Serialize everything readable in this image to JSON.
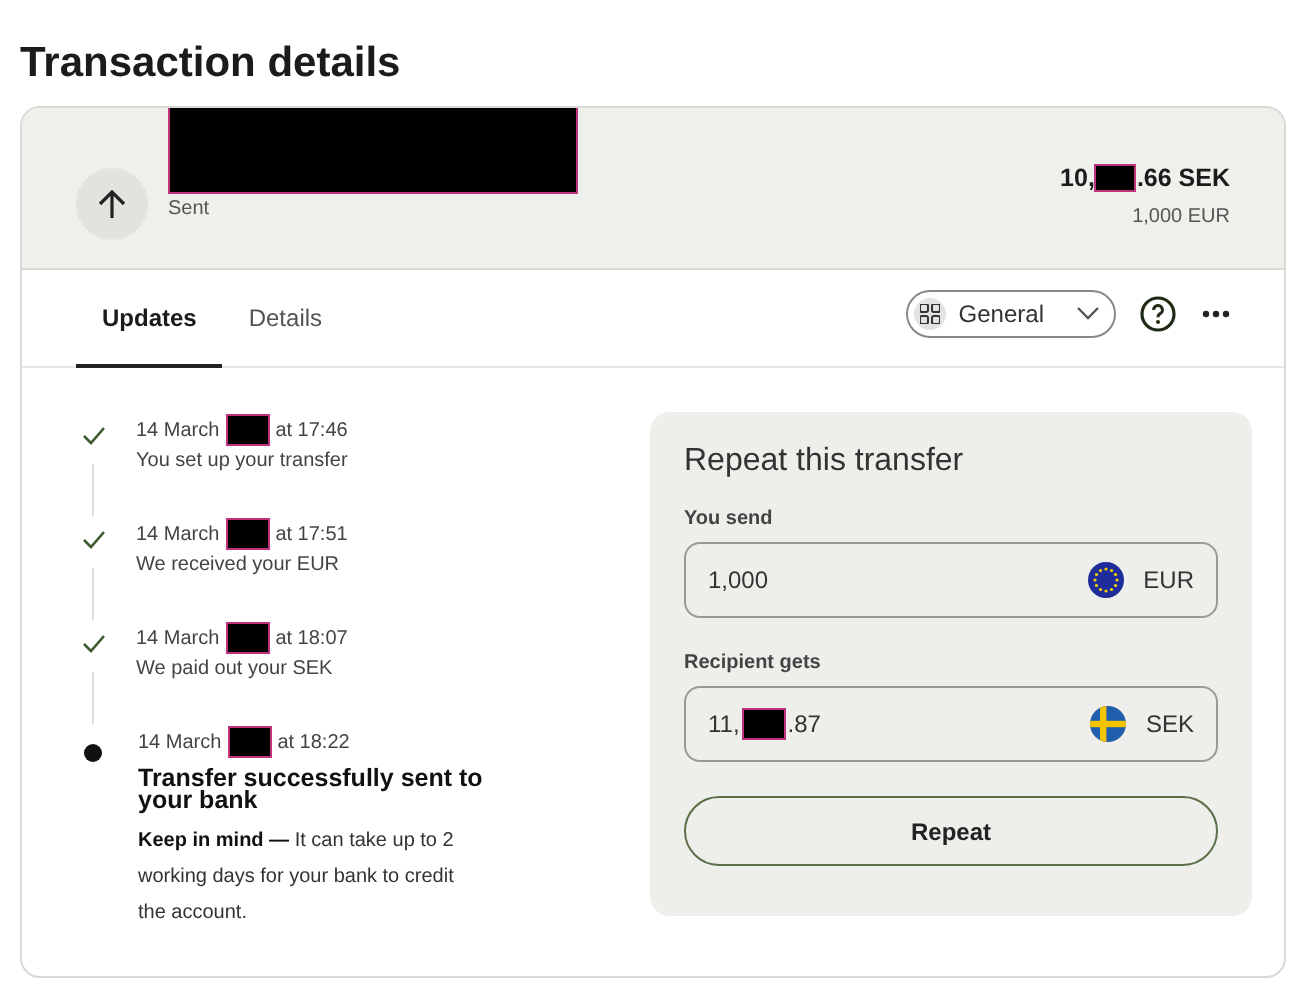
{
  "page": {
    "title": "Transaction details"
  },
  "transaction": {
    "status": "Sent",
    "amount_before": "10,",
    "amount_after": ".66 SEK",
    "source_amount": "1,000 EUR"
  },
  "tabs": [
    {
      "label": "Updates",
      "selected": true
    },
    {
      "label": "Details",
      "selected": false
    }
  ],
  "account_selector": {
    "label": "General"
  },
  "timeline": [
    {
      "date": "14 March",
      "time": "at 17:46",
      "text": "You set up your transfer",
      "kind": "done"
    },
    {
      "date": "14 March",
      "time": "at 17:51",
      "text": "We received your EUR",
      "kind": "done"
    },
    {
      "date": "14 March",
      "time": "at 18:07",
      "text": "We paid out your SEK",
      "kind": "done"
    },
    {
      "date": "14 March",
      "time": "at 18:22",
      "text": "Transfer successfully sent to your bank",
      "kind": "current",
      "note": "**Keep in mind —** It can take up to 2 working days for your bank to credit the account."
    }
  ],
  "repeat": {
    "title": "Repeat this transfer",
    "fields": [
      {
        "label": "You send",
        "value_before": "1,000",
        "currency": "EUR",
        "kind": "eu"
      },
      {
        "label": "Recipient gets",
        "value_before": "11,",
        "value_after": ".87",
        "currency": "SEK",
        "kind": "se"
      }
    ],
    "button": "Repeat"
  }
}
